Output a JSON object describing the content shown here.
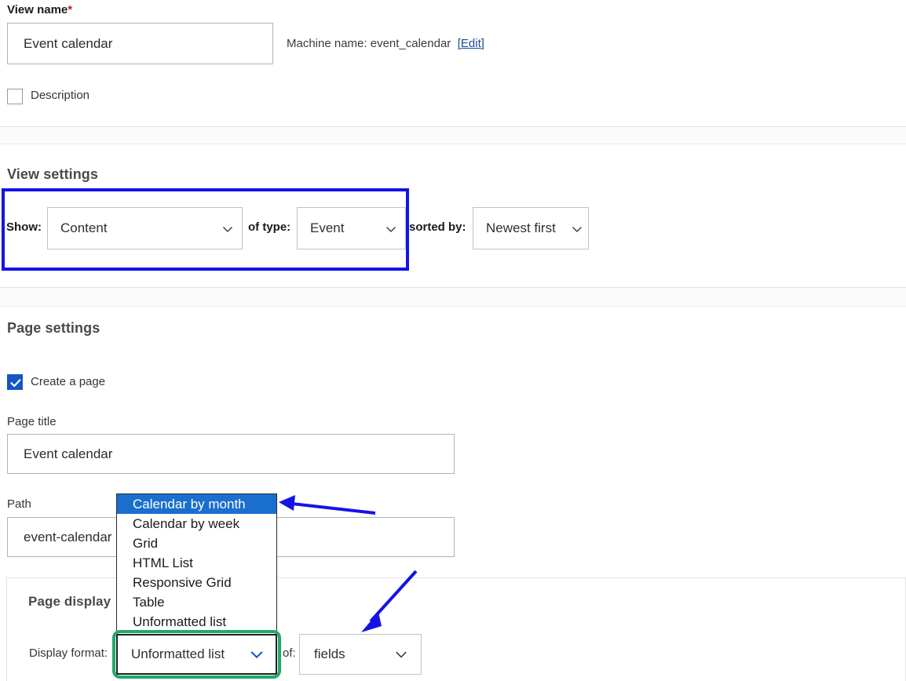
{
  "form": {
    "view_name_label": "View name",
    "required_marker": "*",
    "view_name_value": "Event calendar",
    "machine_name_text": "Machine name: event_calendar",
    "machine_name_edit": "[Edit]",
    "description_checkbox_label": "Description",
    "description_checked": false
  },
  "view_settings": {
    "title": "View settings",
    "show_label": "Show:",
    "show_value": "Content",
    "of_type_label": "of type:",
    "of_type_value": "Event",
    "sorted_by_label": "sorted by:",
    "sorted_by_value": "Newest first"
  },
  "page_settings": {
    "title": "Page settings",
    "create_page_label": "Create a page",
    "create_page_checked": true,
    "page_title_label": "Page title",
    "page_title_value": "Event calendar",
    "path_label": "Path",
    "path_value": "event-calendar"
  },
  "page_display": {
    "title": "Page display",
    "display_format_label": "Display format:",
    "display_format_value": "Unformatted list",
    "of_label": "of:",
    "of_value": "fields"
  },
  "display_format_dropdown": {
    "open": true,
    "selected": "Calendar by month",
    "options": [
      "Calendar by month",
      "Calendar by week",
      "Grid",
      "HTML List",
      "Responsive Grid",
      "Table",
      "Unformatted list"
    ]
  },
  "annotations": {
    "highlight_blue_color": "#1512e8",
    "highlight_green_color": "#21a86a",
    "arrow_color": "#1512e8",
    "arrow_count": 2,
    "blue_rect_target": "view-settings-row",
    "green_rect_target": "display-format-select"
  },
  "icons": {
    "chevron_down": "chevron-down-icon",
    "checkmark": "checkmark-icon"
  }
}
